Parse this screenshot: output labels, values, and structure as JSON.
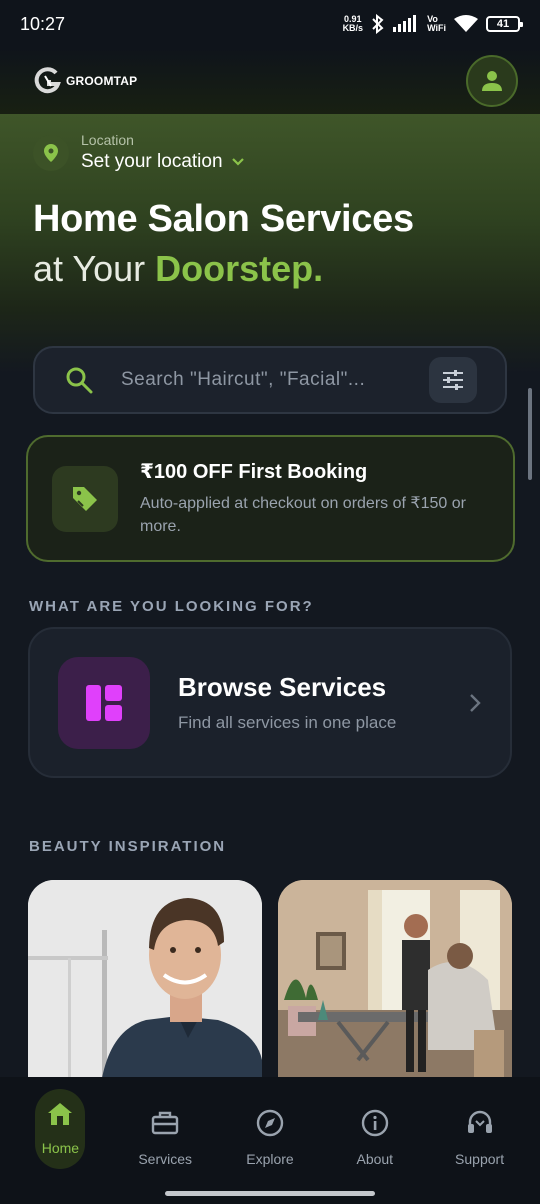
{
  "status_bar": {
    "time": "10:27",
    "net_speed_value": "0.91",
    "net_speed_unit": "KB/s",
    "vowifi_top": "Vo",
    "vowifi_bottom": "WiFi",
    "battery": "41"
  },
  "header": {
    "logo_text": "GROOMTAP",
    "profile_icon": "person-icon"
  },
  "location": {
    "label": "Location",
    "value": "Set your location"
  },
  "hero": {
    "title": "Home Salon Services",
    "subtitle_prefix": "at Your ",
    "subtitle_accent": "Doorstep."
  },
  "search": {
    "placeholder": "Search \"Haircut\", \"Facial\"..."
  },
  "offer": {
    "title": "₹100 OFF First Booking",
    "description": "Auto-applied at checkout on orders of ₹150 or more."
  },
  "sections": {
    "looking_for": "WHAT ARE YOU LOOKING FOR?",
    "inspiration": "BEAUTY INSPIRATION"
  },
  "browse": {
    "title": "Browse Services",
    "subtitle": "Find all services in one place"
  },
  "nav": {
    "items": [
      {
        "label": "Home",
        "icon": "home-icon",
        "active": true
      },
      {
        "label": "Services",
        "icon": "toolbox-icon",
        "active": false
      },
      {
        "label": "Explore",
        "icon": "compass-icon",
        "active": false
      },
      {
        "label": "About",
        "icon": "info-icon",
        "active": false
      },
      {
        "label": "Support",
        "icon": "headset-icon",
        "active": false
      }
    ]
  },
  "colors": {
    "accent": "#8bc34a",
    "background": "#131820",
    "browse_icon": "#e040fb"
  }
}
